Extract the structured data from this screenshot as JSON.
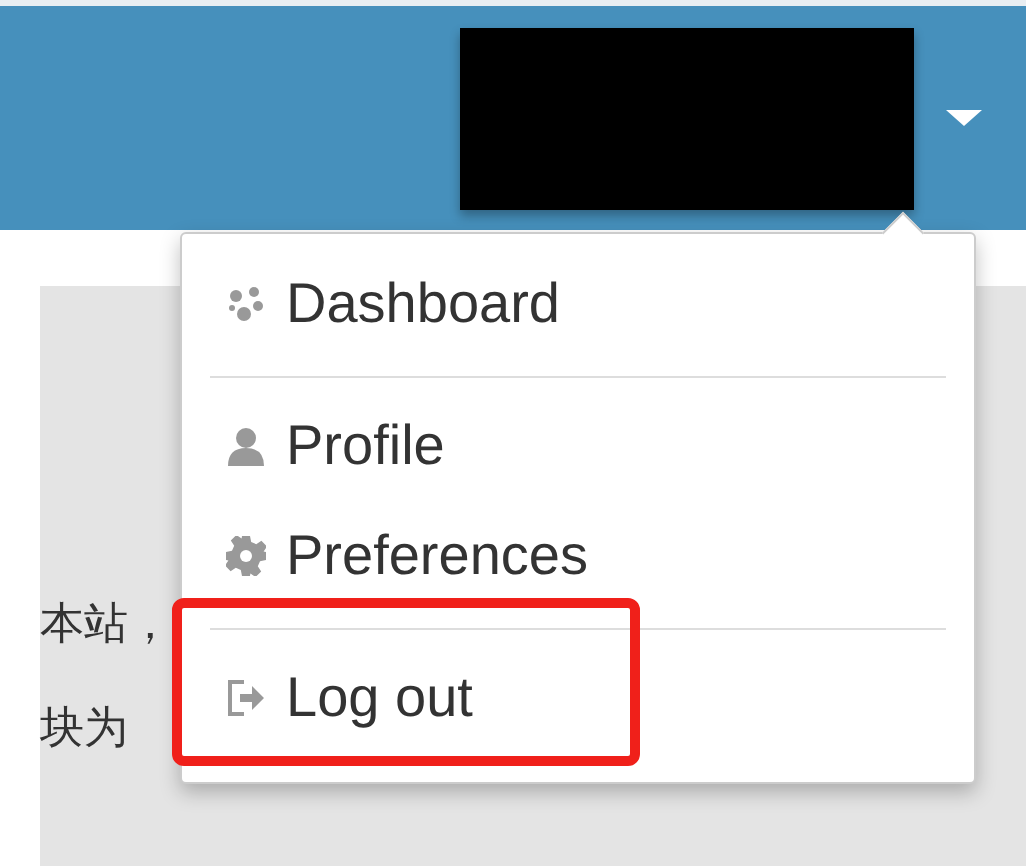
{
  "menu": {
    "items": [
      {
        "label": "Dashboard",
        "kind": "dashboard",
        "divider_before": false,
        "highlighted": false
      },
      {
        "label": "Profile",
        "kind": "profile",
        "divider_before": true,
        "highlighted": false
      },
      {
        "label": "Preferences",
        "kind": "preferences",
        "divider_before": false,
        "highlighted": false
      },
      {
        "label": "Log out",
        "kind": "logout",
        "divider_before": true,
        "highlighted": true
      }
    ]
  },
  "content": {
    "lines": [
      "本站，",
      "块为"
    ]
  }
}
